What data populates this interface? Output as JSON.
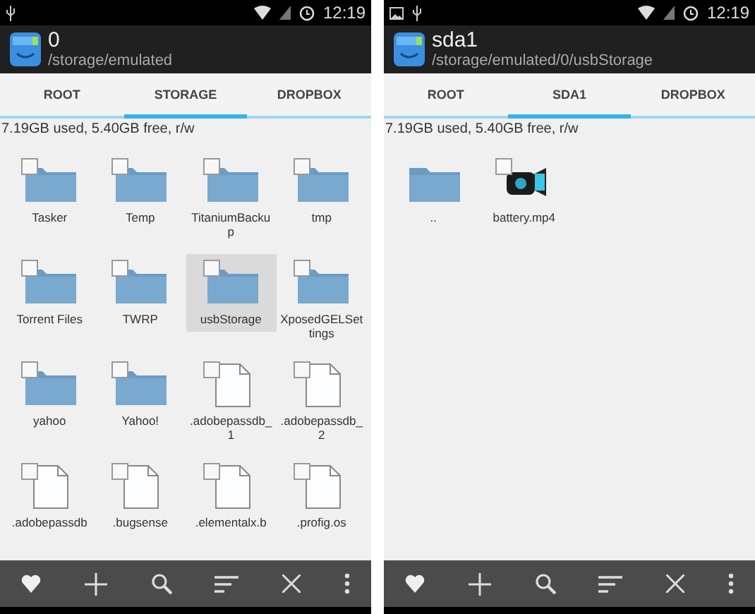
{
  "screens": [
    {
      "status_bar": {
        "notifications": [
          {
            "kind": "usb"
          }
        ],
        "time": "12:19"
      },
      "app_bar": {
        "title": "0",
        "path": "/storage/emulated"
      },
      "tabs": [
        {
          "label": "ROOT",
          "selected": false
        },
        {
          "label": "STORAGE",
          "selected": true
        },
        {
          "label": "DROPBOX",
          "selected": false
        }
      ],
      "info": "7.19GB used, 5.40GB free, r/w",
      "files": [
        {
          "name": "Tasker",
          "kind": "folder",
          "checked": false,
          "selected": false
        },
        {
          "name": "Temp",
          "kind": "folder",
          "checked": false,
          "selected": false
        },
        {
          "name": "TitaniumBackup",
          "kind": "folder",
          "checked": false,
          "selected": false
        },
        {
          "name": "tmp",
          "kind": "folder",
          "checked": false,
          "selected": false
        },
        {
          "name": "Torrent Files",
          "kind": "folder",
          "checked": false,
          "selected": false
        },
        {
          "name": "TWRP",
          "kind": "folder",
          "checked": false,
          "selected": false
        },
        {
          "name": "usbStorage",
          "kind": "folder",
          "checked": false,
          "selected": true
        },
        {
          "name": "XposedGELSettings",
          "kind": "folder",
          "checked": false,
          "selected": false
        },
        {
          "name": "yahoo",
          "kind": "folder",
          "checked": false,
          "selected": false
        },
        {
          "name": "Yahoo!",
          "kind": "folder",
          "checked": false,
          "selected": false
        },
        {
          "name": ".adobepassdb_1",
          "kind": "file",
          "checked": false,
          "selected": false
        },
        {
          "name": ".adobepassdb_2",
          "kind": "file",
          "checked": false,
          "selected": false
        },
        {
          "name": ".adobepassdb",
          "kind": "file",
          "checked": false,
          "selected": false
        },
        {
          "name": ".bugsense",
          "kind": "file",
          "checked": false,
          "selected": false
        },
        {
          "name": ".elementalx.b",
          "kind": "file",
          "checked": false,
          "selected": false
        },
        {
          "name": ".profig.os",
          "kind": "file",
          "checked": false,
          "selected": false
        }
      ]
    },
    {
      "status_bar": {
        "notifications": [
          {
            "kind": "image"
          },
          {
            "kind": "usb"
          }
        ],
        "time": "12:19"
      },
      "app_bar": {
        "title": "sda1",
        "path": "/storage/emulated/0/usbStorage"
      },
      "tabs": [
        {
          "label": "ROOT",
          "selected": false
        },
        {
          "label": "SDA1",
          "selected": true
        },
        {
          "label": "DROPBOX",
          "selected": false
        }
      ],
      "info": "7.19GB used, 5.40GB free, r/w",
      "files": [
        {
          "name": "..",
          "kind": "up",
          "selected": false
        },
        {
          "name": "battery.mp4",
          "kind": "video",
          "checked": false,
          "selected": false
        }
      ]
    }
  ]
}
